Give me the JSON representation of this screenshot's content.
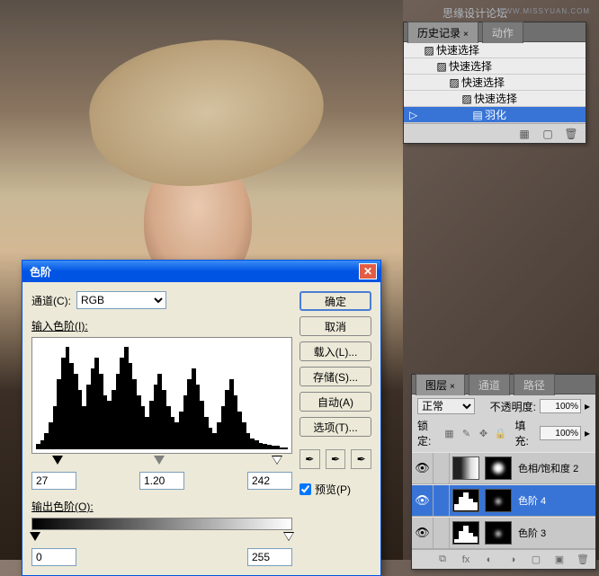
{
  "watermark": {
    "main": "思缘设计论坛",
    "url": "WWW.MISSYUAN.COM"
  },
  "history": {
    "tab_history": "历史记录",
    "tab_actions": "动作",
    "items": [
      {
        "label": "快速选择"
      },
      {
        "label": "快速选择"
      },
      {
        "label": "快速选择"
      },
      {
        "label": "快速选择"
      },
      {
        "label": "羽化"
      }
    ]
  },
  "levels": {
    "title": "色阶",
    "channel_label": "通道(C):",
    "channel_value": "RGB",
    "input_label": "输入色阶(I):",
    "output_label": "输出色阶(O):",
    "shadow": "27",
    "mid": "1.20",
    "highlight": "242",
    "out_shadow": "0",
    "out_highlight": "255",
    "buttons": {
      "ok": "确定",
      "cancel": "取消",
      "load": "载入(L)...",
      "save": "存储(S)...",
      "auto": "自动(A)",
      "options": "选项(T)..."
    },
    "preview": "预览(P)"
  },
  "layers": {
    "tab_layers": "图层",
    "tab_channels": "通道",
    "tab_paths": "路径",
    "blend_mode": "正常",
    "opacity_label": "不透明度:",
    "opacity_value": "100%",
    "lock_label": "锁定:",
    "fill_label": "填充:",
    "fill_value": "100%",
    "items": [
      {
        "name": "色相/饱和度 2"
      },
      {
        "name": "色阶 4"
      },
      {
        "name": "色阶 3"
      }
    ]
  }
}
